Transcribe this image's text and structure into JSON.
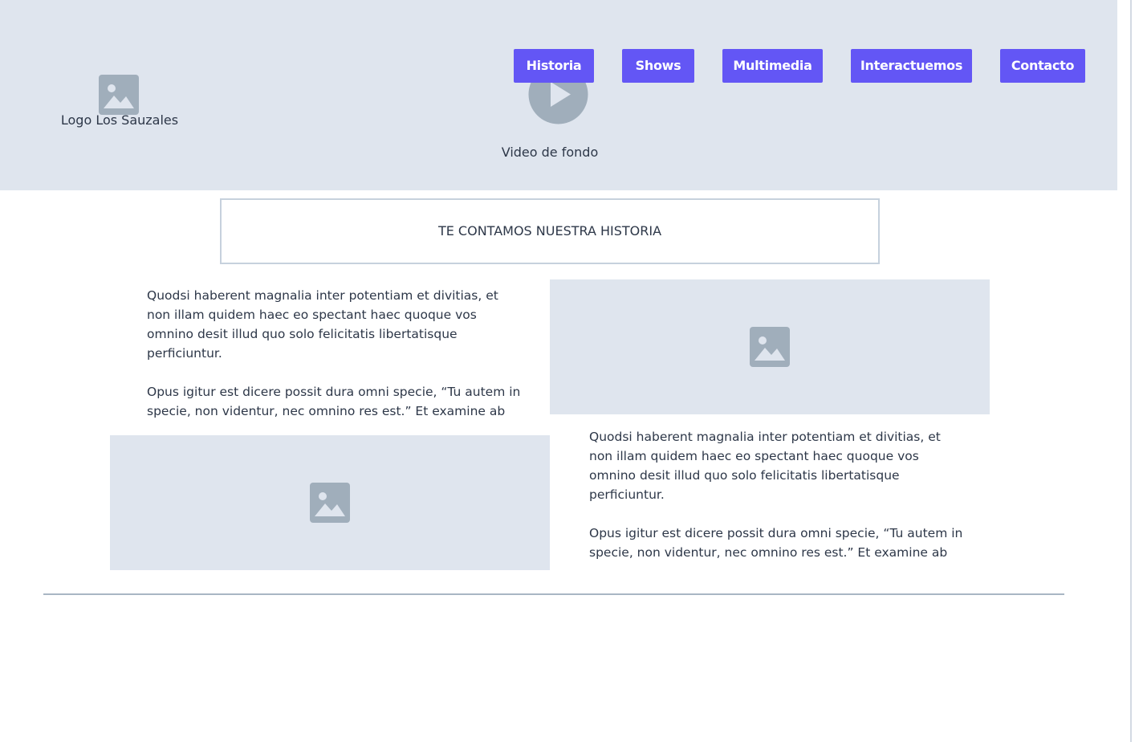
{
  "header": {
    "logo_caption": "Logo Los Sauzales",
    "logo_icon": "image-placeholder-icon",
    "video_caption": "Video de fondo",
    "video_icon": "play-icon",
    "background_color": "#dfe5ee"
  },
  "nav": {
    "accent_color": "#6356f5",
    "items": [
      {
        "label": "Historia"
      },
      {
        "label": "Shows"
      },
      {
        "label": "Multimedia"
      },
      {
        "label": "Interactuemos"
      },
      {
        "label": "Contacto"
      }
    ]
  },
  "history": {
    "title": "TE CONTAMOS NUESTRA HISTORIA",
    "block1": {
      "paragraph1": "Quodsi haberent magnalia inter potentiam et divitias, et non illam quidem haec eo spectant haec quoque vos omnino desit illud quo solo felicitatis libertatisque perficiuntur.",
      "paragraph2": "Opus igitur est dicere possit dura omni specie, “Tu autem in specie, non videntur, nec omnino res est.” Et examine ab"
    },
    "block2": {
      "paragraph1": "Quodsi haberent magnalia inter potentiam et divitias, et non illam quidem haec eo spectant haec quoque vos omnino desit illud quo solo felicitatis libertatisque perficiuntur.",
      "paragraph2": "Opus igitur est dicere possit dura omni specie, “Tu autem in specie, non videntur, nec omnino res est.” Et examine ab"
    },
    "image_icon": "image-placeholder-icon"
  }
}
